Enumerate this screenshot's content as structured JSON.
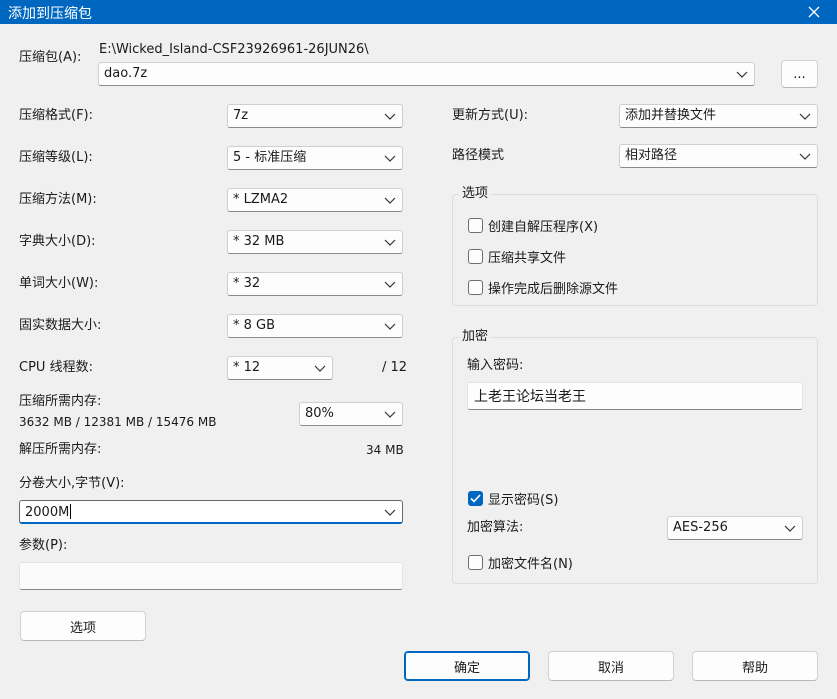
{
  "window": {
    "title": "添加到压缩包"
  },
  "archive": {
    "label": "压缩包(A):",
    "path": "E:\\Wicked_Island-CSF23926961-26JUN26\\",
    "name": "dao.7z",
    "browse_label": "..."
  },
  "left": {
    "format": {
      "label": "压缩格式(F):",
      "value": "7z"
    },
    "level": {
      "label": "压缩等级(L):",
      "value": "5 - 标准压缩"
    },
    "method": {
      "label": "压缩方法(M):",
      "value": "* LZMA2"
    },
    "dict": {
      "label": "字典大小(D):",
      "value": "* 32 MB"
    },
    "word": {
      "label": "单词大小(W):",
      "value": "* 32"
    },
    "solid": {
      "label": "固实数据大小:",
      "value": "* 8 GB"
    },
    "threads": {
      "label": "CPU 线程数:",
      "value": "* 12",
      "max": "/ 12"
    },
    "mem_compress": {
      "label": "压缩所需内存:",
      "detail": "3632 MB / 12381 MB / 15476 MB",
      "percent": "80%"
    },
    "mem_decompress": {
      "label": "解压所需内存:",
      "value": "34 MB"
    },
    "volume": {
      "label": "分卷大小,字节(V):",
      "value": "2000M"
    },
    "params": {
      "label": "参数(P):",
      "value": ""
    },
    "options_button": "选项"
  },
  "right": {
    "update": {
      "label": "更新方式(U):",
      "value": "添加并替换文件"
    },
    "pathmode": {
      "label": "路径模式",
      "value": "相对路径"
    },
    "options_group": {
      "title": "选项",
      "items": [
        {
          "label": "创建自解压程序(X)",
          "checked": false
        },
        {
          "label": "压缩共享文件",
          "checked": false
        },
        {
          "label": "操作完成后删除源文件",
          "checked": false
        }
      ]
    },
    "encryption": {
      "title": "加密",
      "password_label": "输入密码:",
      "password": "上老王论坛当老王",
      "show_password": {
        "label": "显示密码(S)",
        "checked": true
      },
      "method_label": "加密算法:",
      "method": "AES-256",
      "encrypt_names": {
        "label": "加密文件名(N)",
        "checked": false
      }
    }
  },
  "footer": {
    "ok": "确定",
    "cancel": "取消",
    "help": "帮助"
  },
  "colors": {
    "accent": "#0067c0",
    "background": "#f0f0f0"
  }
}
